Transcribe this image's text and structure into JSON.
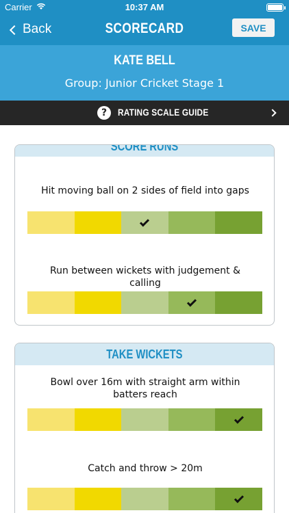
{
  "status_bar": {
    "carrier": "Carrier",
    "time": "10:37 AM"
  },
  "nav": {
    "back_label": "Back",
    "title": "SCORECARD",
    "save_label": "SAVE"
  },
  "player": {
    "name": "KATE BELL",
    "group": "Group: Junior Cricket Stage 1"
  },
  "guide": {
    "label": "RATING SCALE GUIDE",
    "icon": "question-circle-icon",
    "arrow": "chevron-right-icon"
  },
  "rating_colors": [
    "#f7e36f",
    "#f1d900",
    "#bace8f",
    "#96b95a",
    "#77a132"
  ],
  "sections": [
    {
      "title": "SCORE RUNS",
      "skills": [
        {
          "text": "Hit moving ball on 2 sides of field into gaps",
          "rating": 3
        },
        {
          "text": "Run between wickets with judgement & calling",
          "rating": 4
        }
      ]
    },
    {
      "title": "TAKE WICKETS",
      "skills": [
        {
          "text": "Bowl over 16m with straight arm within batters reach",
          "rating": 5
        },
        {
          "text": "Catch and throw > 20m",
          "rating": 5
        }
      ]
    }
  ]
}
